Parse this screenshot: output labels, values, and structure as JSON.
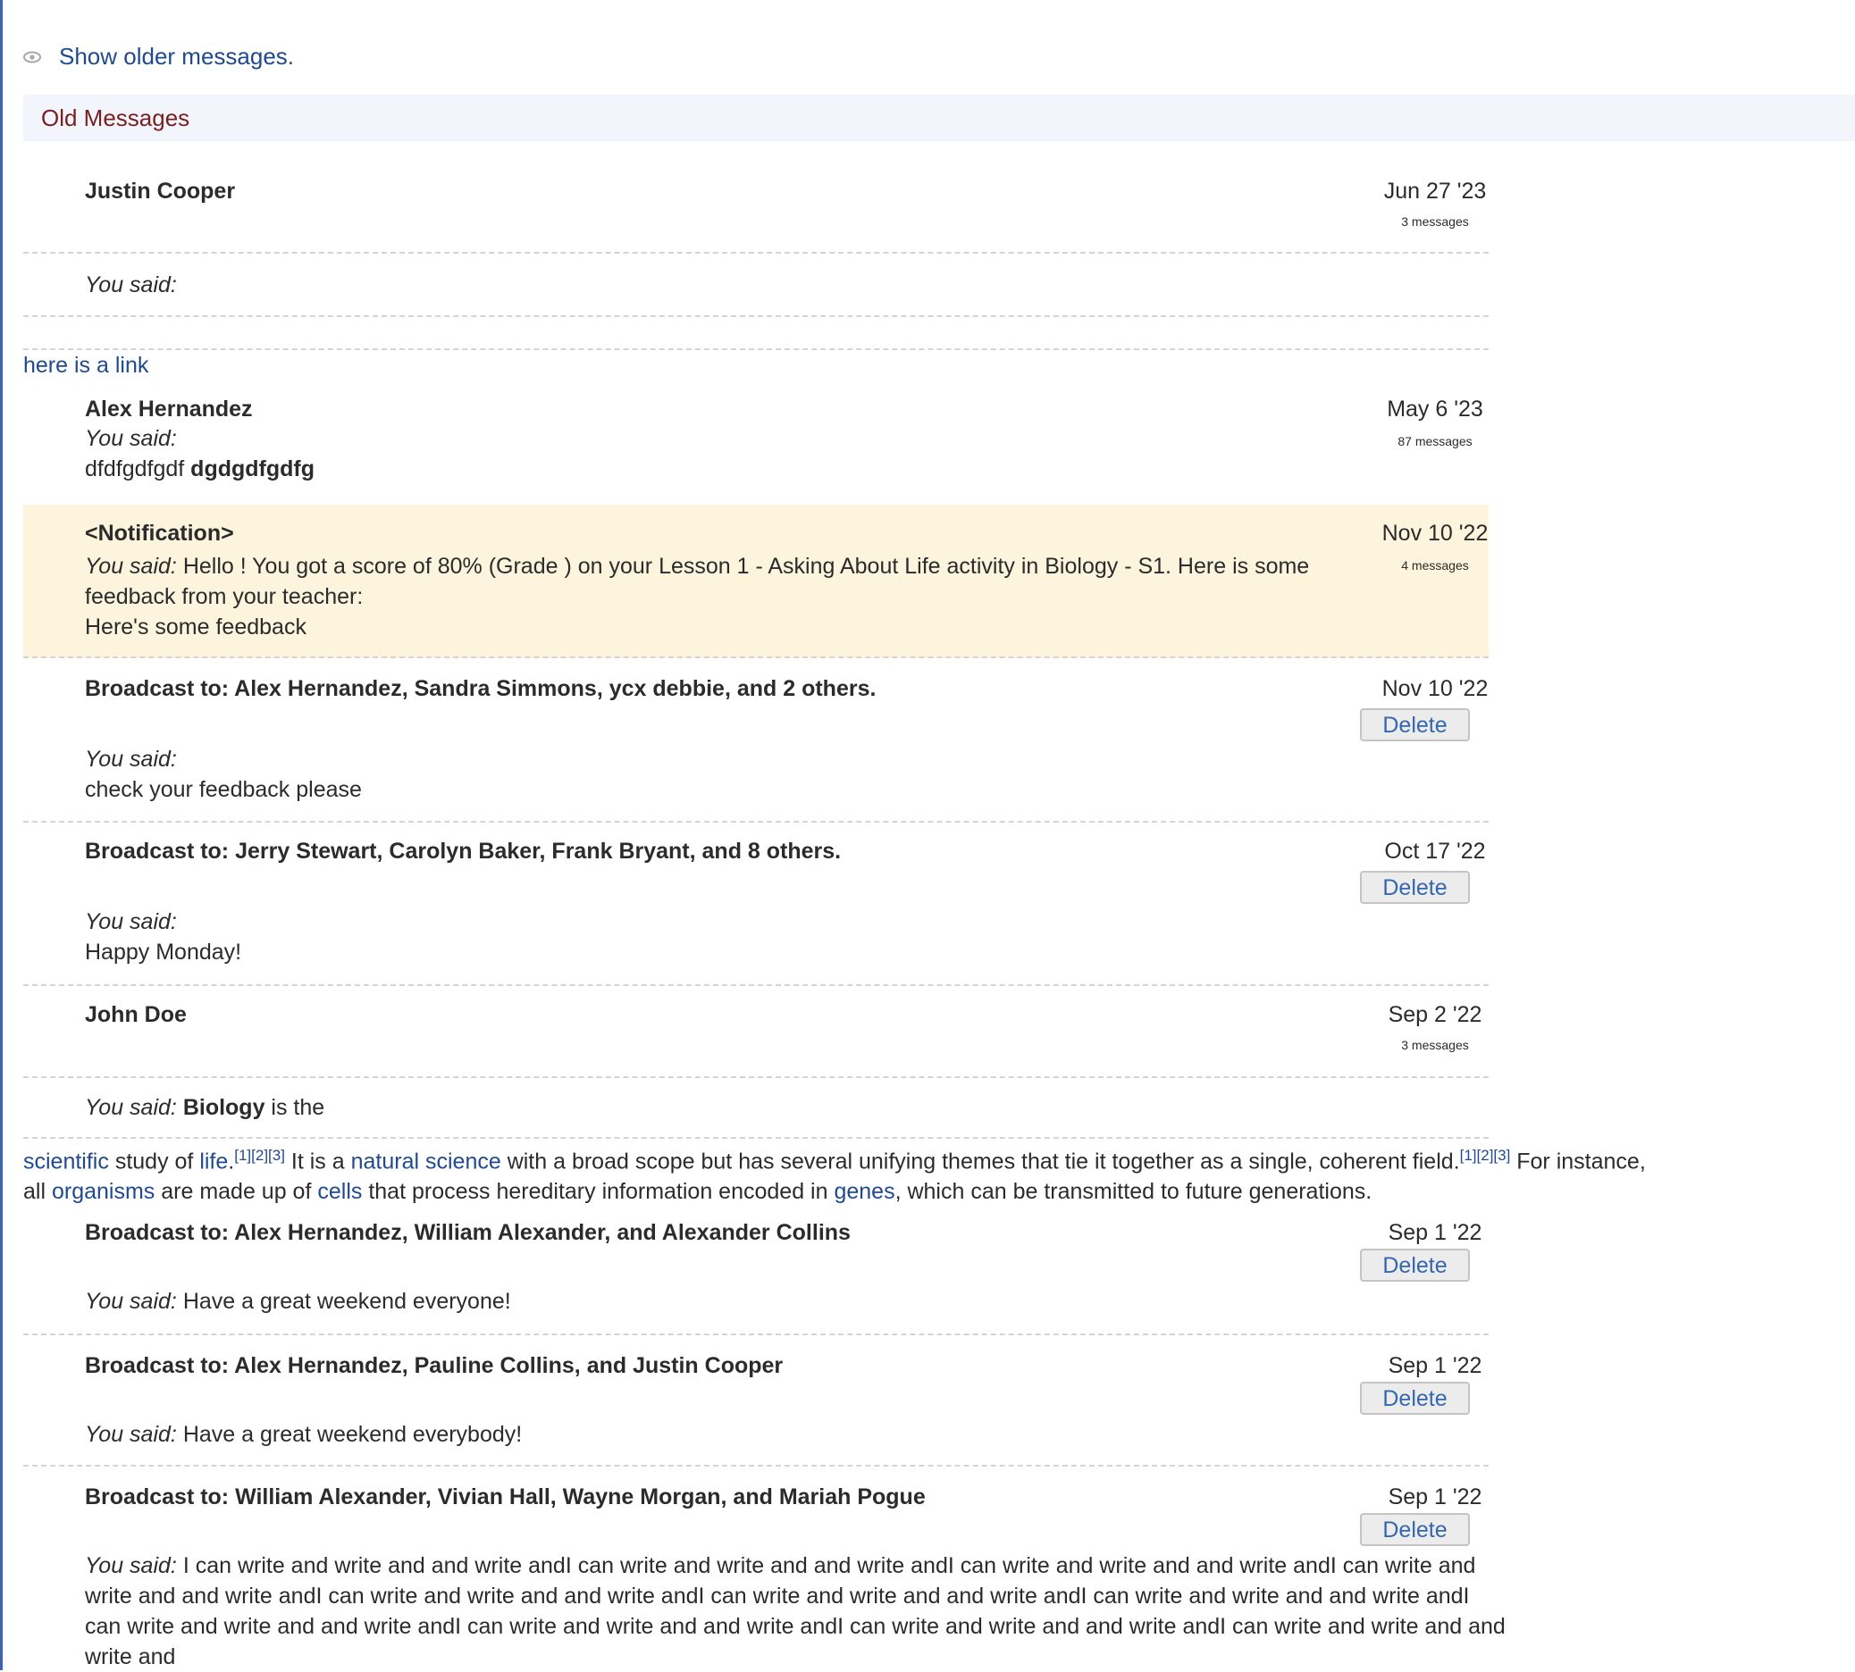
{
  "show_older": "Show older messages.",
  "old_header": "Old Messages",
  "you_said": "You said:",
  "delete_label": "Delete",
  "free_link": "here is a link",
  "threads": {
    "t1": {
      "name": "Justin Cooper",
      "date": "Jun 27 '23",
      "count": "3 messages"
    },
    "t2": {
      "name": "Alex Hernandez",
      "date": "May 6 '23",
      "count": "87 messages",
      "body_plain": "dfdfgdfgdf",
      "body_bold": "dgdgdfgdfg"
    },
    "t3": {
      "name": "<Notification>",
      "date": "Nov 10 '22",
      "count": "4 messages",
      "body_line1": "Hello ! You got a score of 80% (Grade ) on your Lesson 1 - Asking About Life activity in Biology - S1. Here is some",
      "body_line2": "feedback from your teacher:",
      "body_line3": "Here's some feedback"
    },
    "t4": {
      "name": "Broadcast to: Alex Hernandez, Sandra Simmons, ycx debbie, and 2 others.",
      "date": "Nov 10 '22",
      "body": "check your feedback please"
    },
    "t5": {
      "name": "Broadcast to: Jerry Stewart, Carolyn Baker, Frank Bryant, and 8 others.",
      "date": "Oct 17 '22",
      "body": "Happy Monday!"
    },
    "t6": {
      "name": "John Doe",
      "date": "Sep 2 '22",
      "count": "3 messages"
    },
    "t7": {
      "name": "Broadcast to: Alex Hernandez, William Alexander, and Alexander Collins",
      "date": "Sep 1 '22",
      "body": "Have a great weekend everyone!"
    },
    "t8": {
      "name": "Broadcast to: Alex Hernandez, Pauline Collins, and Justin Cooper",
      "date": "Sep 1 '22",
      "body": "Have a great weekend everybody!"
    },
    "t9": {
      "name": "Broadcast to: William Alexander, Vivian Hall, Wayne Morgan, and Mariah Pogue",
      "date": "Sep 1 '22",
      "body": "I can write and write and and write andI can write and write and and write andI can write and write and and write andI can write and write and and write andI can write and write and and write andI can write and write and and write andI can write and write and and write andI can write and write and and write andI can write and write and and write andI can write and write and and write andI can write and write and and write and"
    }
  },
  "biology": {
    "you_said_bold": "Biology",
    "you_said_rest": " is the",
    "w_scientific": "scientific",
    "t_study": " study of ",
    "w_life": "life",
    "t_period": ".",
    "refs": "[1][2][3]",
    "t_natural_pre": " It is a ",
    "w_natural": "natural science",
    "t_scope": " with a broad scope but has several unifying themes that tie it together as a single, coherent field.",
    "t_instance": " For instance,",
    "t_all": "all ",
    "w_organisms": "organisms",
    "t_made": " are made up of ",
    "w_cells": "cells",
    "t_process": " that process hereditary information encoded in ",
    "w_genes": "genes",
    "t_transmit": ", which can be transmitted to future generations."
  },
  "colors": {
    "link": "#1f4a8f",
    "header_text": "#7a1f1f",
    "header_bg": "#f2f6fc",
    "notification_bg": "#fcf4dc",
    "left_rule": "#3a64b4"
  }
}
